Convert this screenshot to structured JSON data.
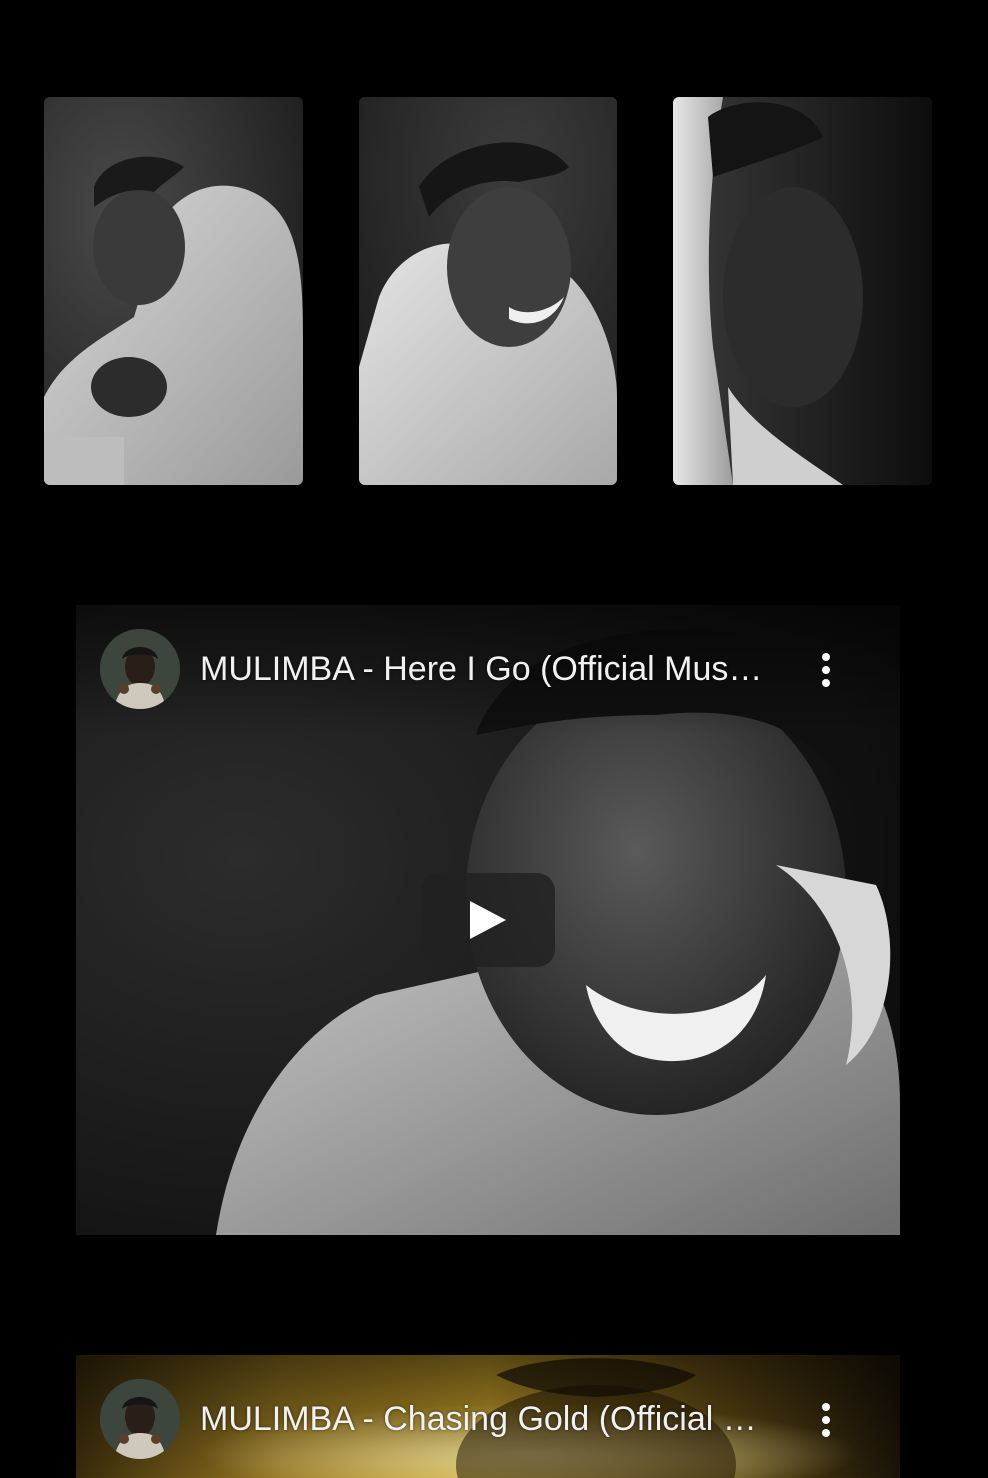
{
  "gallery": {
    "photos": [
      {
        "alt_icon": "portrait-photo-icon"
      },
      {
        "alt_icon": "portrait-photo-icon"
      },
      {
        "alt_icon": "portrait-photo-icon"
      }
    ]
  },
  "videos": [
    {
      "title": "MULIMBA - Here I Go (Official Mus…",
      "has_play_button": true,
      "menu_icon": "more-vertical-icon",
      "play_icon": "play-icon"
    },
    {
      "title": "MULIMBA - Chasing Gold (Official …",
      "has_play_button": false,
      "menu_icon": "more-vertical-icon"
    }
  ],
  "colors": {
    "page_background": "#000000",
    "title_text": "#f1f1f1",
    "play_button_bg": "#212121",
    "video2_tint": "#c8a12a"
  }
}
